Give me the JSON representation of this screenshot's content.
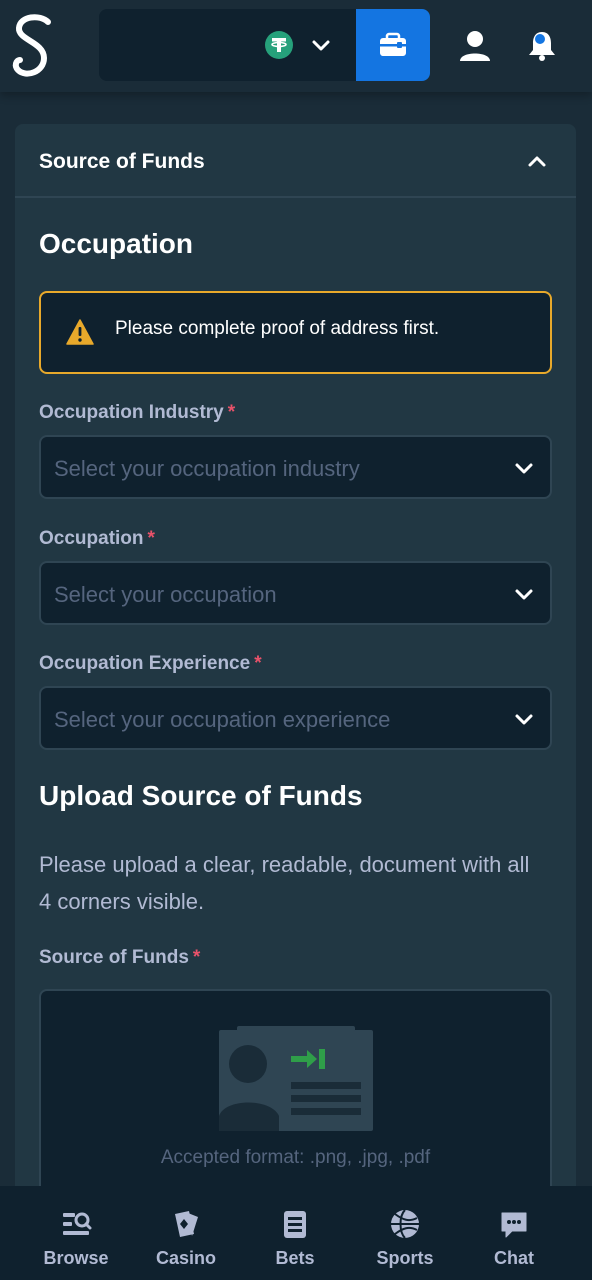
{
  "colors": {
    "background": "#1a2c38",
    "card": "#213743",
    "input": "#0f212e",
    "accent_blue": "#1475e1",
    "warning": "#e8a92b",
    "required": "#e9526a",
    "muted_text": "#b1bad3",
    "placeholder": "#55657e",
    "currency_green": "#26a17b"
  },
  "header": {
    "logo_icon": "stake-s-logo",
    "currency_icon": "tether-usdt-icon",
    "wallet_icon": "wallet-icon",
    "user_icon": "user-icon",
    "notification_icon": "bell-icon"
  },
  "section": {
    "title": "Source of Funds"
  },
  "occupation": {
    "heading": "Occupation",
    "alert_text": "Please complete proof of address first.",
    "fields": [
      {
        "label": "Occupation Industry",
        "required_mark": "*",
        "placeholder": "Select your occupation industry"
      },
      {
        "label": "Occupation",
        "required_mark": "*",
        "placeholder": "Select your occupation"
      },
      {
        "label": "Occupation Experience",
        "required_mark": "*",
        "placeholder": "Select your occupation experience"
      }
    ]
  },
  "upload": {
    "heading": "Upload Source of Funds",
    "instructions": "Please upload a clear, readable, document with all 4 corners visible.",
    "label": "Source of Funds",
    "required_mark": "*",
    "format_text": "Accepted format: .png, .jpg, .pdf"
  },
  "bottom_nav": [
    {
      "label": "Browse",
      "icon": "browse-icon"
    },
    {
      "label": "Casino",
      "icon": "casino-cards-icon"
    },
    {
      "label": "Bets",
      "icon": "bets-slip-icon"
    },
    {
      "label": "Sports",
      "icon": "basketball-icon"
    },
    {
      "label": "Chat",
      "icon": "chat-bubble-icon"
    }
  ]
}
